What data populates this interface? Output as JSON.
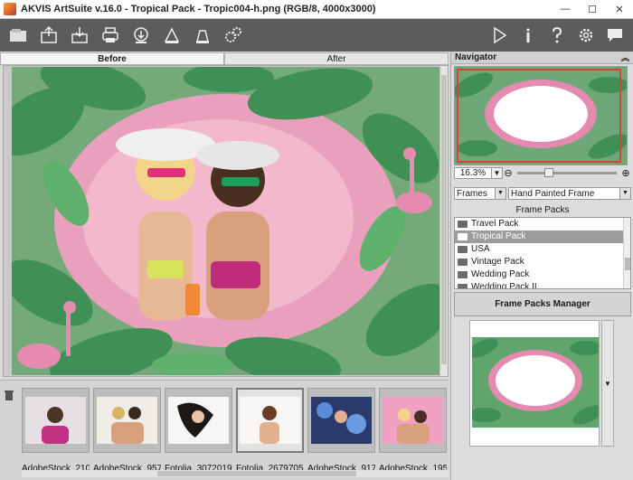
{
  "window": {
    "title": "AKVIS ArtSuite v.16.0 - Tropical Pack - Tropic004-h.png (RGB/8, 4000x3000)",
    "minimize": "—",
    "maximize": "☐",
    "close": "✕"
  },
  "toolbar": {
    "left_icons": [
      "app-logo-icon",
      "open-icon",
      "save-icon",
      "print-icon",
      "share-icon",
      "batch-icon",
      "stamp-icon",
      "gear-cluster-icon"
    ],
    "right_icons": [
      "run-icon",
      "info-icon",
      "help-icon",
      "settings-icon",
      "chat-icon"
    ]
  },
  "tabs": {
    "before": "Before",
    "after": "After"
  },
  "filmstrip": {
    "items": [
      {
        "label": "AdobeStock_210..."
      },
      {
        "label": "AdobeStock_957..."
      },
      {
        "label": "Fotolia_3072019..."
      },
      {
        "label": "Fotolia_2679705..."
      },
      {
        "label": "AdobeStock_917..."
      },
      {
        "label": "AdobeStock_195..."
      }
    ]
  },
  "navigator": {
    "title": "Navigator",
    "zoom": "16.3%",
    "zoom_minus": "⊖",
    "zoom_plus": "⊕"
  },
  "frames": {
    "type": "Frames",
    "style": "Hand Painted Frame",
    "packs_title": "Frame Packs",
    "packs": [
      "Travel Pack",
      "Tropical Pack",
      "USA",
      "Vintage Pack",
      "Wedding Pack",
      "Wedding Pack II"
    ],
    "selected_pack": "Tropical Pack",
    "manager_button": "Frame Packs Manager"
  },
  "colors": {
    "accent": "#d8403a",
    "toolbar": "#5c5c5c",
    "leaf": "#3f8f57",
    "pink": "#e58bb0"
  }
}
